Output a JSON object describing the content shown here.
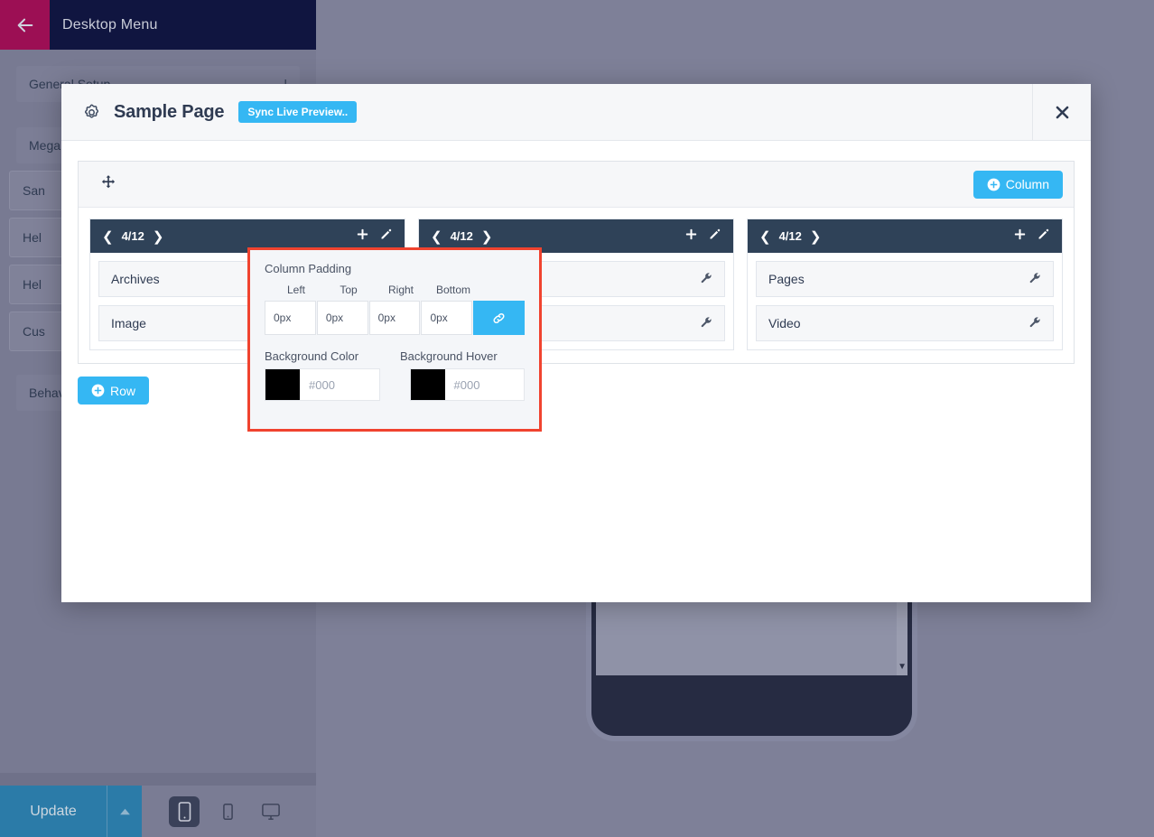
{
  "admin": {
    "back_icon": "arrow-left-icon",
    "title": "Desktop Menu",
    "groups": [
      {
        "label": "General Setup",
        "caret": "|"
      },
      {
        "label": "Mega"
      }
    ],
    "sub_items": [
      {
        "label": "San"
      },
      {
        "label": "Hel"
      },
      {
        "label": "Hel"
      },
      {
        "label": "Cus"
      }
    ],
    "bottom_group": {
      "label": "Behav"
    },
    "footer": {
      "update_label": "Update",
      "caret_icon": "caret-up-icon",
      "devices": [
        {
          "name": "mobile-icon",
          "active": true
        },
        {
          "name": "tablet-icon",
          "active": false
        },
        {
          "name": "desktop-icon",
          "active": false
        }
      ]
    }
  },
  "modal": {
    "gear_icon": "gear-icon",
    "title": "Sample Page",
    "sync_label": "Sync Live Preview..",
    "close_icon": "close-icon",
    "row": {
      "drag_icon": "move-icon",
      "add_column_label": "Column",
      "add_column_icon": "plus-circle-icon",
      "add_row_label": "Row",
      "add_row_icon": "plus-circle-icon",
      "columns": [
        {
          "prev_icon": "chevron-left-icon",
          "width_fraction": "4/12",
          "next_icon": "chevron-right-icon",
          "add_icon": "plus-icon",
          "edit_icon": "pencil-icon",
          "items": [
            {
              "label": "Archives",
              "tool_icon": "wrench-icon"
            },
            {
              "label": "Image",
              "tool_icon": "wrench-icon"
            }
          ]
        },
        {
          "prev_icon": "chevron-left-icon",
          "width_fraction": "4/12",
          "next_icon": "chevron-right-icon",
          "add_icon": "plus-icon",
          "edit_icon": "pencil-icon",
          "items": [
            {
              "label": "",
              "tool_icon": "wrench-icon"
            },
            {
              "label": "",
              "tool_icon": "wrench-icon"
            }
          ]
        },
        {
          "prev_icon": "chevron-left-icon",
          "width_fraction": "4/12",
          "next_icon": "chevron-right-icon",
          "add_icon": "plus-icon",
          "edit_icon": "pencil-icon",
          "items": [
            {
              "label": "Pages",
              "tool_icon": "wrench-icon"
            },
            {
              "label": "Video",
              "tool_icon": "wrench-icon"
            }
          ]
        }
      ]
    }
  },
  "settings_popup": {
    "padding_label": "Column Padding",
    "padding_fields": [
      {
        "label": "Left",
        "value": "0px"
      },
      {
        "label": "Top",
        "value": "0px"
      },
      {
        "label": "Right",
        "value": "0px"
      },
      {
        "label": "Bottom",
        "value": "0px"
      }
    ],
    "link_icon": "link-icon",
    "background_color": {
      "label": "Background Color",
      "swatch": "#000000",
      "placeholder": "#000"
    },
    "background_hover": {
      "label": "Background Hover",
      "swatch": "#000000",
      "placeholder": "#000"
    },
    "highlight_color": "#f0432f"
  },
  "colors": {
    "accent_blue": "#35b7f3",
    "column_header": "#2f4258",
    "topbar": "#101540",
    "back_magenta": "#9c0f54",
    "update_blue": "#2b7ba8"
  }
}
